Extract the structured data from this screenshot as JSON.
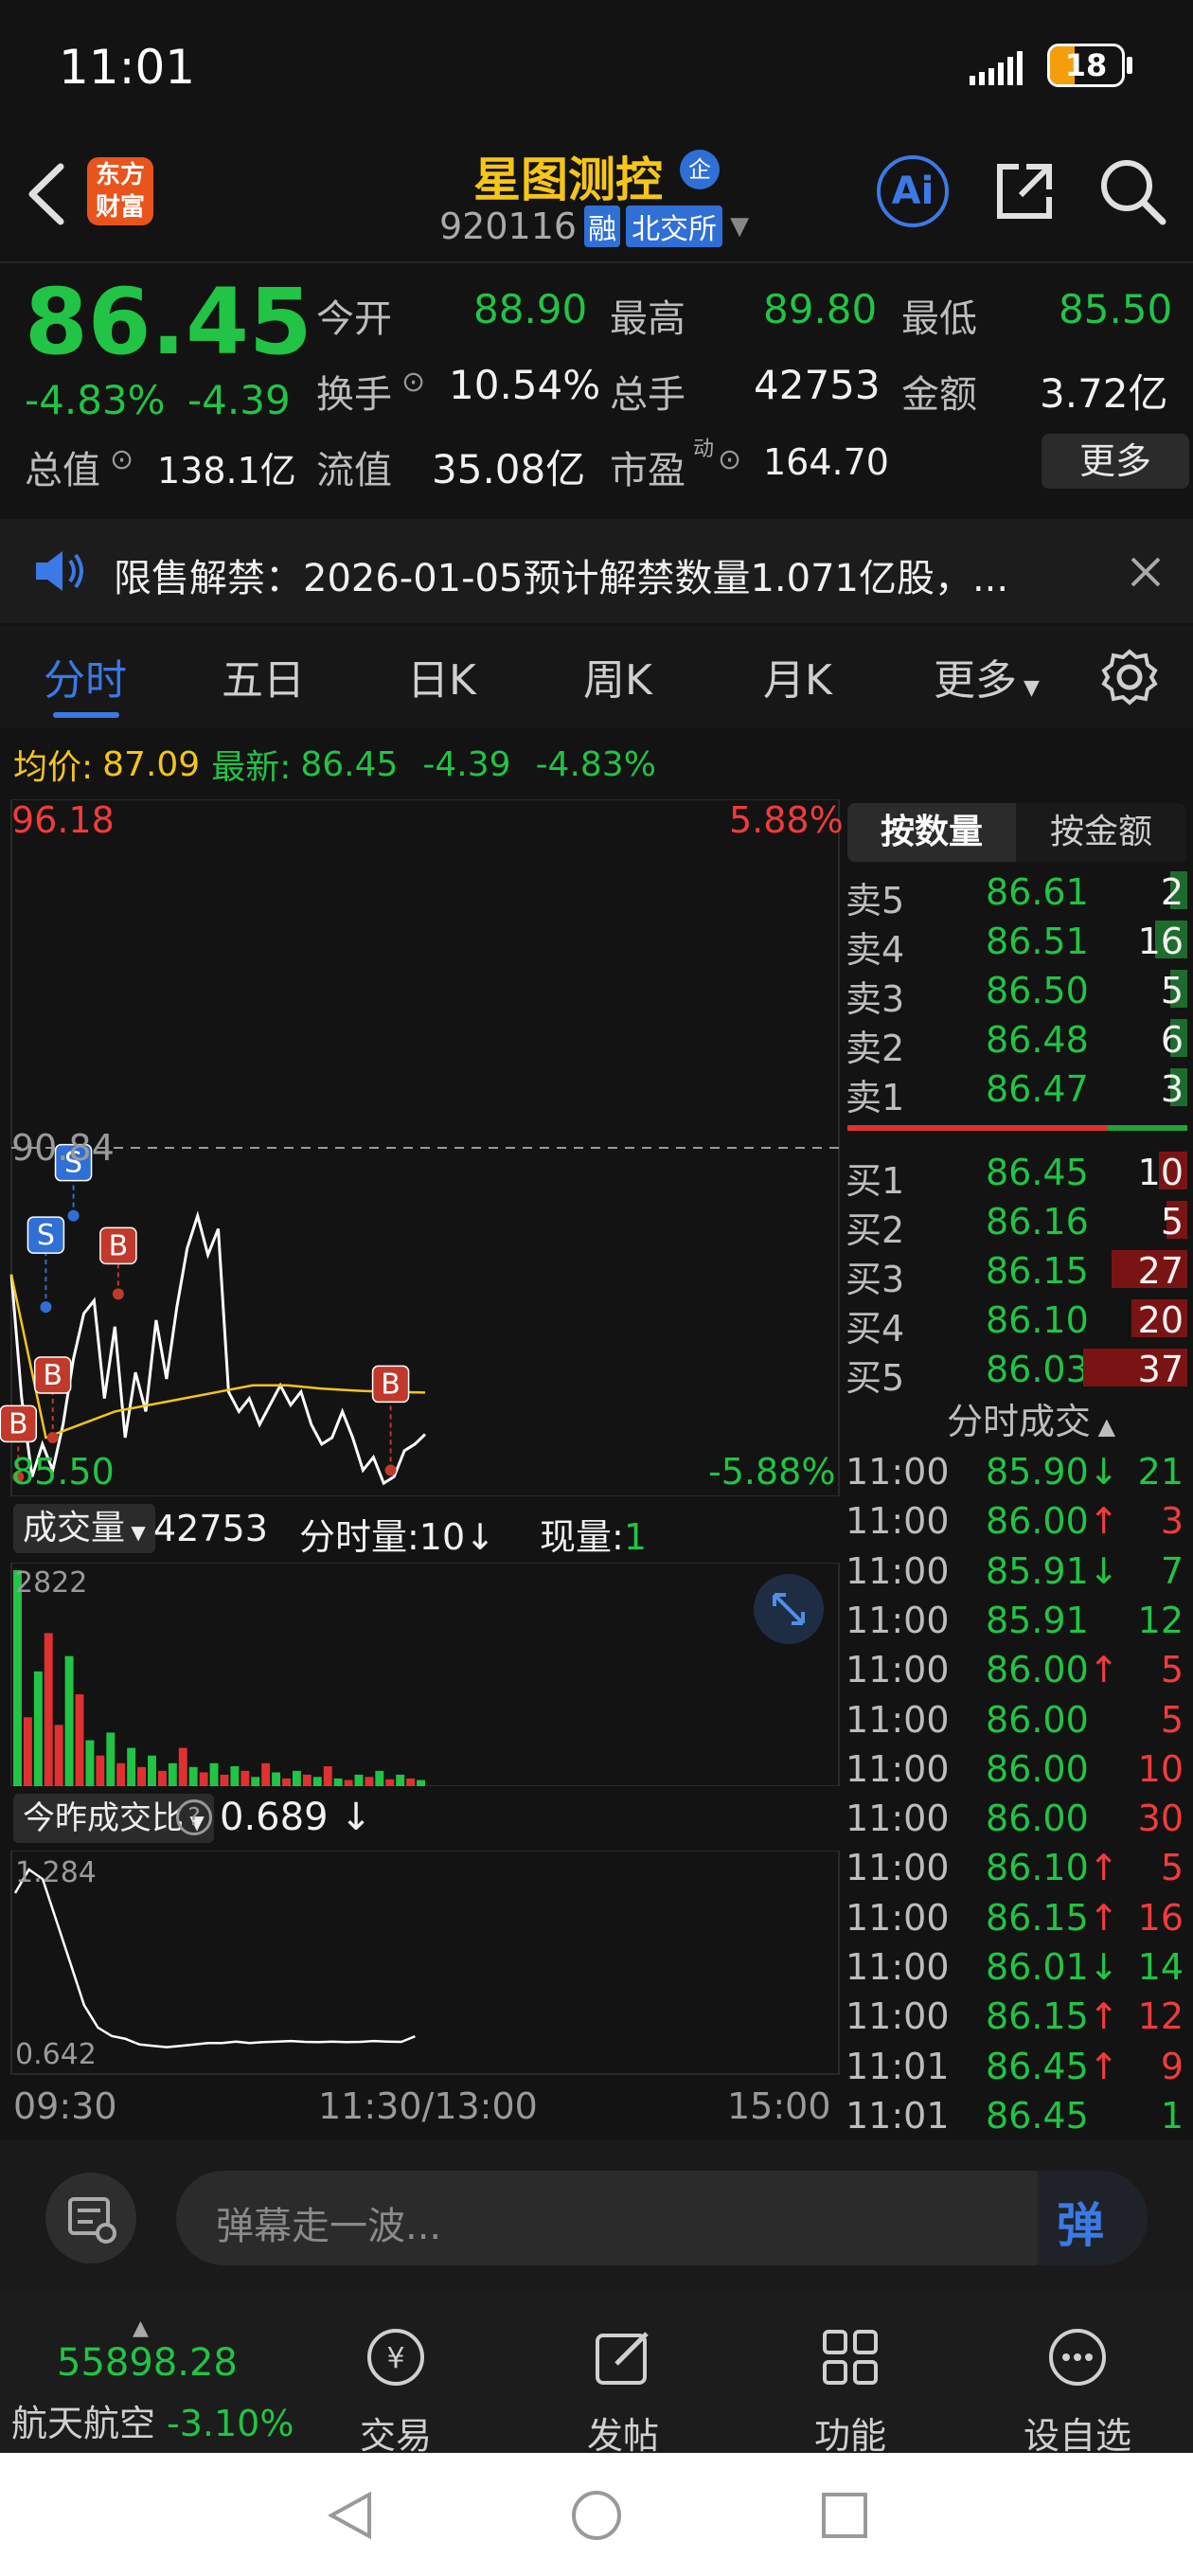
{
  "status_bar": {
    "time": "11:01",
    "battery": "18"
  },
  "header": {
    "title": "星图测控",
    "badge_zheng": "企",
    "code": "920116",
    "tag_rong": "融",
    "exchange": "北交所",
    "logo_line1": "东方",
    "logo_line2": "财富",
    "ai_label": "Ai"
  },
  "quote": {
    "price": "86.45",
    "change_pct": "-4.83%",
    "change_amt": "-4.39",
    "open_label": "今开",
    "open": "88.90",
    "high_label": "最高",
    "high": "89.80",
    "low_label": "最低",
    "low": "85.50",
    "turnover_label": "换手",
    "turnover": "10.54%",
    "total_hands_label": "总手",
    "total_hands": "42753",
    "amount_label": "金额",
    "amount": "3.72亿",
    "mktcap_label": "总值",
    "mktcap": "138.1亿",
    "float_label": "流值",
    "float": "35.08亿",
    "pe_label": "市盈",
    "pe_sup": "动",
    "pe": "164.70",
    "more_button": "更多"
  },
  "notice": {
    "text": "限售解禁：2026-01-05预计解禁数量1.071亿股，..."
  },
  "tabs": [
    "分时",
    "五日",
    "日K",
    "周K",
    "月K",
    "更多"
  ],
  "info_line": {
    "avg_label": "均价:",
    "avg": "87.09",
    "latest_label": "最新:",
    "latest": "86.45",
    "chg": "-4.39",
    "pct": "-4.83%"
  },
  "chart_labels": {
    "top_price": "96.18",
    "top_pct": "5.88%",
    "mid_price": "90.84",
    "bottom_price": "85.50",
    "bottom_pct": "-5.88%",
    "vol_selector": "成交量",
    "vol_total": "42753",
    "vol_minute": "分时量:10↓",
    "vol_now_label": "现量:",
    "vol_now": "1",
    "vol_max": "2822",
    "ratio_selector": "今昨成交比",
    "ratio_value": "0.689 ↓",
    "ratio_max": "1.284",
    "ratio_min": "0.642",
    "time_start": "09:30",
    "time_mid": "11:30/13:00",
    "time_end": "15:00",
    "markers": [
      "S",
      "S",
      "B",
      "B",
      "B",
      "B"
    ]
  },
  "chart_data": {
    "type": "line",
    "title": "",
    "x_range": [
      "09:30",
      "15:00"
    ],
    "y_range": [
      85.5,
      96.18
    ],
    "reference_price": 90.84,
    "series": [
      {
        "name": "",
        "color": "#ffffff",
        "x": [
          0,
          3,
          6,
          9,
          12,
          15,
          18,
          21,
          24,
          27,
          30,
          33,
          36,
          39,
          42,
          45,
          48,
          51,
          54,
          57,
          60,
          63,
          66,
          69,
          72,
          75,
          78,
          81,
          84,
          87,
          90,
          93,
          96,
          99,
          102,
          105,
          108,
          111,
          114,
          117,
          120
        ],
        "values": [
          88.9,
          87.0,
          85.8,
          86.3,
          85.9,
          86.6,
          87.6,
          88.3,
          88.5,
          87.0,
          88.1,
          86.4,
          87.4,
          86.8,
          88.2,
          87.3,
          88.4,
          89.3,
          89.8,
          89.2,
          89.6,
          87.1,
          86.8,
          87.0,
          86.6,
          86.9,
          87.2,
          86.9,
          87.1,
          86.6,
          86.3,
          86.4,
          86.8,
          86.4,
          85.9,
          86.1,
          85.7,
          85.8,
          86.2,
          86.3,
          86.45
        ]
      },
      {
        "name": "均价",
        "color": "#f5c518",
        "x": [
          0,
          10,
          20,
          30,
          40,
          50,
          60,
          70,
          80,
          90,
          100,
          110,
          120
        ],
        "values": [
          88.9,
          86.4,
          86.6,
          86.8,
          86.9,
          87.0,
          87.1,
          87.2,
          87.2,
          87.15,
          87.12,
          87.1,
          87.09
        ]
      }
    ],
    "volume": [
      2822,
      900,
      1500,
      2000,
      800,
      1700,
      1200,
      600,
      400,
      700,
      300,
      500,
      250,
      400,
      200,
      300,
      500,
      250,
      180,
      300,
      150,
      260,
      200,
      120,
      300,
      180,
      100,
      200,
      150,
      120,
      260,
      100,
      80,
      150,
      120,
      200,
      90,
      150,
      100,
      80
    ],
    "volume_colors": [
      "g",
      "r",
      "g",
      "r",
      "r",
      "g",
      "r",
      "g",
      "r",
      "g",
      "r",
      "g",
      "r",
      "g",
      "r",
      "g",
      "r",
      "g",
      "r",
      "g",
      "r",
      "g",
      "r",
      "g",
      "r",
      "g",
      "r",
      "g",
      "r",
      "g",
      "r",
      "g",
      "r",
      "g",
      "r",
      "g",
      "r",
      "g",
      "r",
      "g"
    ],
    "ratio": [
      1.2,
      1.284,
      1.25,
      1.1,
      0.95,
      0.8,
      0.72,
      0.69,
      0.68,
      0.66,
      0.655,
      0.65,
      0.655,
      0.66,
      0.665,
      0.665,
      0.67,
      0.665,
      0.668,
      0.67,
      0.672,
      0.669,
      0.668,
      0.67,
      0.668,
      0.669,
      0.672,
      0.67,
      0.669,
      0.689
    ]
  },
  "orderbook": {
    "tab_qty": "按数量",
    "tab_amt": "按金额",
    "asks": [
      {
        "label": "卖5",
        "price": "86.61",
        "vol": "2"
      },
      {
        "label": "卖4",
        "price": "86.51",
        "vol": "16"
      },
      {
        "label": "卖3",
        "price": "86.50",
        "vol": "5"
      },
      {
        "label": "卖2",
        "price": "86.48",
        "vol": "6"
      },
      {
        "label": "卖1",
        "price": "86.47",
        "vol": "3"
      }
    ],
    "bids": [
      {
        "label": "买1",
        "price": "86.45",
        "vol": "10"
      },
      {
        "label": "买2",
        "price": "86.16",
        "vol": "5"
      },
      {
        "label": "买3",
        "price": "86.15",
        "vol": "27"
      },
      {
        "label": "买4",
        "price": "86.10",
        "vol": "20"
      },
      {
        "label": "买5",
        "price": "86.03",
        "vol": "37"
      }
    ],
    "ticks_title": "分时成交",
    "ticks": [
      {
        "t": "11:00",
        "p": "85.90↓",
        "v": "21",
        "c": "g"
      },
      {
        "t": "11:00",
        "p": "86.00↑",
        "v": "3",
        "c": "r"
      },
      {
        "t": "11:00",
        "p": "85.91↓",
        "v": "7",
        "c": "g"
      },
      {
        "t": "11:00",
        "p": "85.91",
        "v": "12",
        "c": "g"
      },
      {
        "t": "11:00",
        "p": "86.00↑",
        "v": "5",
        "c": "r"
      },
      {
        "t": "11:00",
        "p": "86.00",
        "v": "5",
        "c": "r"
      },
      {
        "t": "11:00",
        "p": "86.00",
        "v": "10",
        "c": "r"
      },
      {
        "t": "11:00",
        "p": "86.00",
        "v": "30",
        "c": "r"
      },
      {
        "t": "11:00",
        "p": "86.10↑",
        "v": "5",
        "c": "r"
      },
      {
        "t": "11:00",
        "p": "86.15↑",
        "v": "16",
        "c": "r"
      },
      {
        "t": "11:00",
        "p": "86.01↓",
        "v": "14",
        "c": "g"
      },
      {
        "t": "11:00",
        "p": "86.15↑",
        "v": "12",
        "c": "r"
      },
      {
        "t": "11:01",
        "p": "86.45↑",
        "v": "9",
        "c": "r"
      },
      {
        "t": "11:01",
        "p": "86.45",
        "v": "1",
        "c": "g"
      }
    ]
  },
  "danmu": {
    "placeholder": "弹幕走一波..."
  },
  "bottom_nav": {
    "index_value": "55898.28",
    "index_name": "航天航空",
    "index_change": "-3.10%",
    "trade": "交易",
    "post": "发帖",
    "func": "功能",
    "watch": "设自选"
  }
}
